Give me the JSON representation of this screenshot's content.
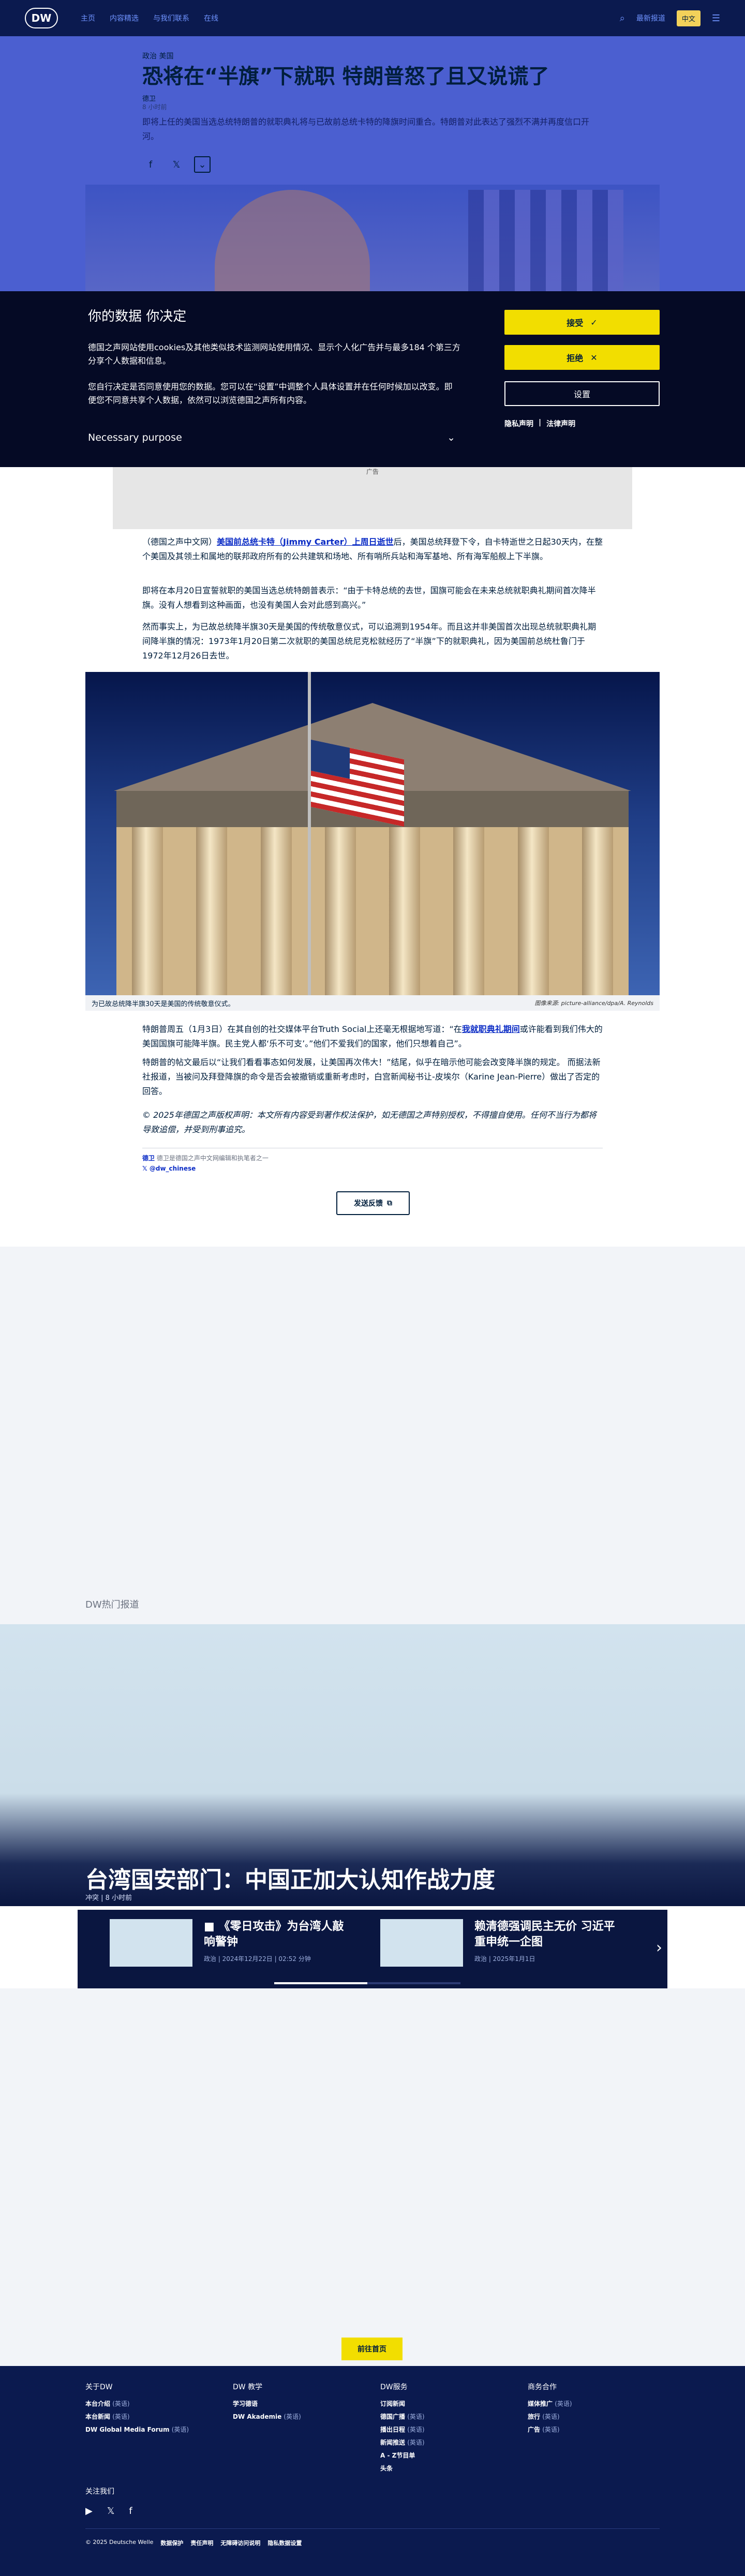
{
  "header": {
    "logo": "DW",
    "nav": [
      "主页",
      "内容精选",
      "与我们联系",
      "在线"
    ],
    "search_label": "最新报道",
    "lang_badge": "中文",
    "grid_icon": "grid-icon"
  },
  "article": {
    "category": "政治 美国",
    "title": "恐将在“半旗”下就职 特朗普怒了且又说谎了",
    "byline": "德卫",
    "date": "8 小时前",
    "lead": "即将上任的美国当选总统特朗普的就职典礼将与已故前总统卡特的降旗时间重合。特朗普对此表达了强烈不满并再度信口开河。",
    "paragraph_a_pre": "（德国之声中文网）",
    "paragraph_a_link": "美国前总统卡特（Jimmy Carter）上周日逝世",
    "paragraph_a_post": "后，美国总统拜登下令，自卡特逝世之日起30天内，在整个美国及其领土和属地的联邦政府所有的公共建筑和场地、所有哨所兵站和海军基地、所有海军船舰上下半旗。",
    "paragraph_b": "即将在本月20日宣誓就职的美国当选总统特朗普表示：“由于卡特总统的去世，国旗可能会在未来总统就职典礼期间首次降半旗。没有人想看到这种画面，也没有美国人会对此感到高兴。”",
    "paragraph_c": "然而事实上，为已故总统降半旗30天是美国的传统敬意仪式，可以追溯到1954年。而且这并非美国首次出现总统就职典礼期间降半旗的情况：1973年1月20日第二次就职的美国总统尼克松就经历了“半旗”下的就职典礼，因为美国前总统杜鲁门于1972年12月26日去世。",
    "image_caption": "为已故总统降半旗30天是美国的传统敬意仪式。",
    "image_credit": "图像来源: picture-alliance/dpa/A. Reynolds",
    "paragraph_d_pre": "特朗普周五（1月3日）在其自创的社交媒体平台Truth Social上还毫无根据地写道：“在",
    "paragraph_d_link": "我就职典礼期间",
    "paragraph_d_post": "或许能看到我们伟大的美国国旗可能降半旗。民主党人都‘乐不可支’。”他们不爱我们的国家，他们只想着自己”。",
    "paragraph_e": "特朗普的帖文最后以“让我们看看事态如何发展，让美国再次伟大！”结尾，似乎在暗示他可能会改变降半旗的规定。 而据法新社报道，当被问及拜登降旗的命令是否会被撤销或重新考虑时，白宫新闻秘书让-皮埃尔（Karine Jean-Pierre）做出了否定的回答。",
    "copyright": "© 2025年德国之声版权声明：本文所有内容受到著作权法保护，如无德国之声特别授权，不得擅自使用。任何不当行为都将导致追偿，并受到刑事追究。",
    "author_name": "德卫",
    "author_role": "德卫是德国之声中文网编辑和执笔者之一",
    "twitter_handle": "@dw_chinese",
    "feedback_label": "发送反馈"
  },
  "consent": {
    "title": "你的数据 你决定",
    "p1": "德国之声网站使用cookies及其他类似技术监测网站使用情况、显示个人化广告并与最多184 个第三方分享个人数据和信息。",
    "p2": "您自行决定是否同意使用您的数据。您可以在“设置”中调整个人具体设置并在任何时候加以改变。即便您不同意共享个人数据，依然可以浏览德国之声所有内容。",
    "purpose": "Necessary purpose",
    "accept": "接受",
    "reject": "拒绝",
    "settings": "设置",
    "privacy": "隐私声明",
    "legal": "法律声明"
  },
  "ad_label": "广告",
  "hot": {
    "section_title": "DW热门报道",
    "feature_title": "台湾国安部门：中国正加大认知作战力度",
    "feature_date": "冲突 | 8 小时前",
    "cards": [
      {
        "title": "《零日攻击》为台湾人敲响警钟",
        "date": "政治 | 2024年12月22日 | 02:52 分钟"
      },
      {
        "title": "赖清德强调民主无价 习近平重申统一企图",
        "date": "政治 | 2025年1月1日"
      }
    ]
  },
  "back_to_top": "前往首页",
  "footer": {
    "col1_title": "关于DW",
    "col1_items": [
      {
        "label": "本台介绍",
        "lang": "(英语)"
      },
      {
        "label": "本台新闻",
        "lang": "(英语)"
      },
      {
        "label": "DW Global Media Forum",
        "lang": "(英语)"
      }
    ],
    "col2_title": "DW 教学",
    "col2_items": [
      {
        "label": "学习德语",
        "lang": ""
      },
      {
        "label": "DW Akademie",
        "lang": "(英语)"
      }
    ],
    "col3_title": "DW服务",
    "col3_items": [
      {
        "label": "订阅新闻",
        "lang": ""
      },
      {
        "label": "德国广播",
        "lang": "(英语)"
      },
      {
        "label": "播出日程",
        "lang": "(英语)"
      },
      {
        "label": "新闻推送",
        "lang": "(英语)"
      },
      {
        "label": "A - Z节目单",
        "lang": ""
      },
      {
        "label": "头条",
        "lang": ""
      }
    ],
    "col4_title": "商务合作",
    "col4_items": [
      {
        "label": "媒体推广",
        "lang": "(英语)"
      },
      {
        "label": "旅行",
        "lang": "(英语)"
      },
      {
        "label": "广告",
        "lang": "(英语)"
      }
    ],
    "follow": "关注我们",
    "legal": [
      "© 2025 Deutsche Welle",
      "数据保护",
      "责任声明",
      "无障碍访问说明",
      "隐私数据设置"
    ]
  }
}
